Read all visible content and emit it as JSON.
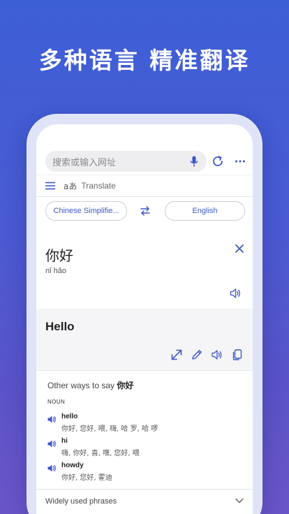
{
  "headline": "多种语言 精准翻译",
  "browser": {
    "search_placeholder": "搜索或输入网址"
  },
  "translate_bar": {
    "logo": "aあ",
    "title": "Translate"
  },
  "languages": {
    "source": "Chinese Simplifie...",
    "target": "English"
  },
  "source": {
    "text": "你好",
    "pinyin": "nǐ hǎo"
  },
  "result": {
    "text": "Hello"
  },
  "other_ways": {
    "title_prefix": "Other ways to say ",
    "title_word": "你好",
    "part_of_speech": "NOUN",
    "items": [
      {
        "word": "hello",
        "back": "你好, 您好, 喂, 嗨, 哈 罗, 哈 啰"
      },
      {
        "word": "hi",
        "back": "嗨, 你好, 喜, 嘿, 您好, 喂"
      },
      {
        "word": "howdy",
        "back": "你好, 您好, 霍迪"
      }
    ]
  },
  "phrases": {
    "label": "Widely used phrases"
  },
  "colors": {
    "accent": "#3d57c8",
    "background_top": "#3d5fd6",
    "background_bottom": "#6a55c8"
  },
  "icons": {
    "mic": "mic-icon",
    "refresh": "refresh-icon",
    "more": "more-icon",
    "menu": "menu-icon",
    "swap": "swap-icon",
    "close": "close-icon",
    "speaker": "speaker-icon",
    "expand": "expand-icon",
    "edit": "pencil-icon",
    "copy": "copy-icon",
    "chevron": "chevron-down-icon"
  }
}
